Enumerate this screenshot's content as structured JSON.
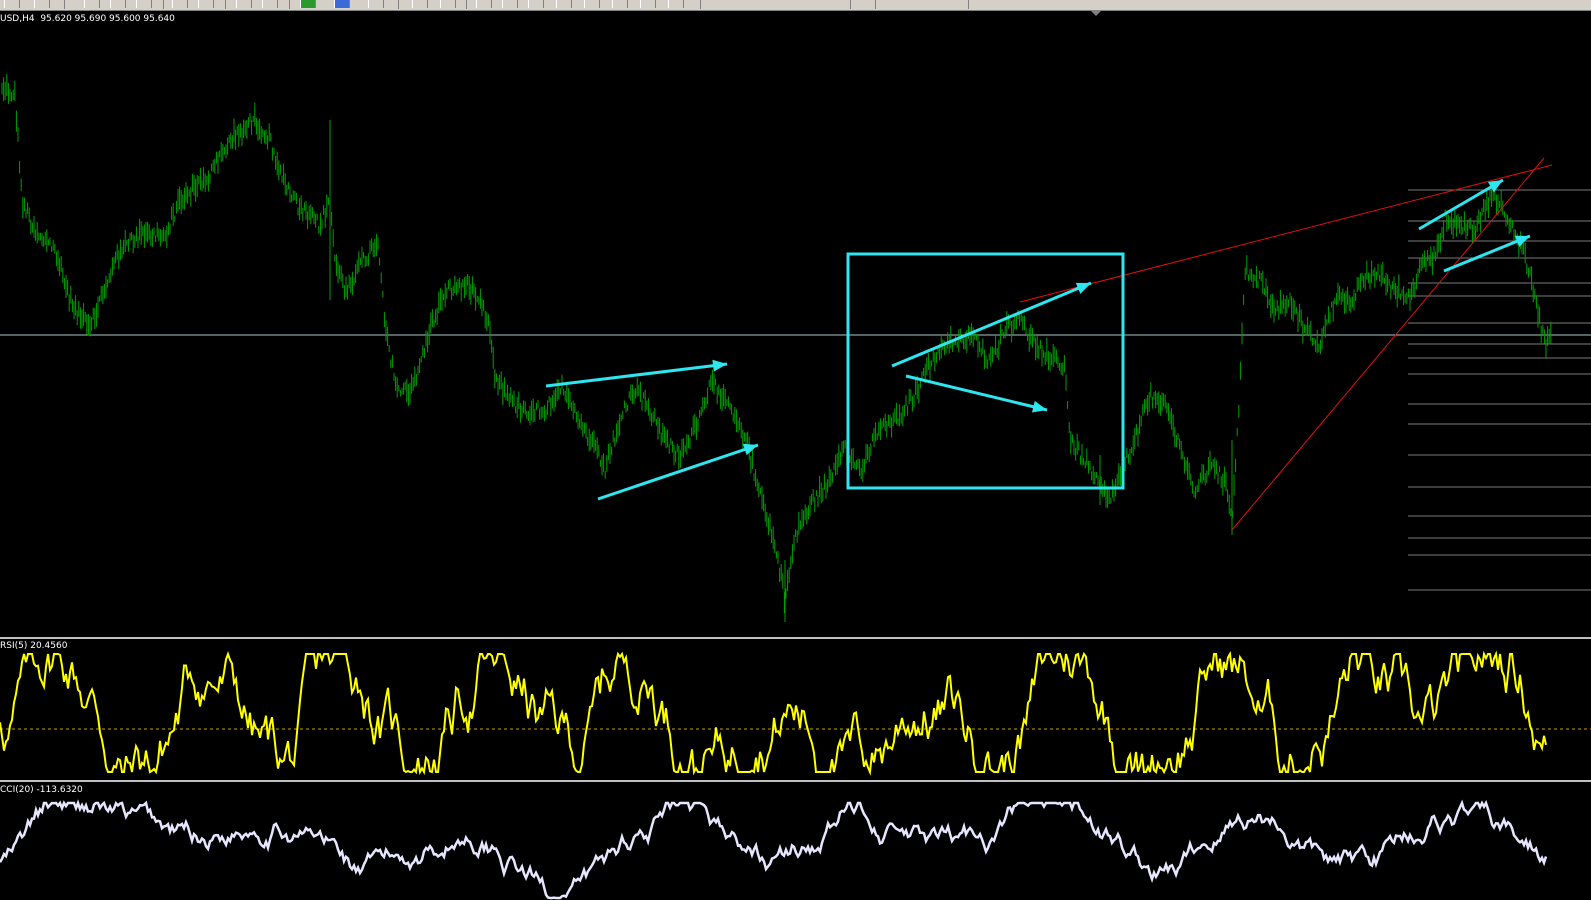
{
  "main_chart": {
    "header": "USD,H4",
    "ohlc": "95.620 95.690 95.600 95.640",
    "bar_color": "#00a000",
    "horizontal_line_color": "#a9c7c9"
  },
  "rsi_panel": {
    "label": "RSI(5) 20.4560",
    "line_color": "#ffff00",
    "level_color": "#c8a000"
  },
  "cci_panel": {
    "label": "CCI(20) -113.6320",
    "line_color": "#e6e6ff"
  },
  "annotations": {
    "arrow_color": "#2ee6f0",
    "rectangle_color": "#2ee6f0",
    "trendline_color": "#e01010"
  },
  "toolbar": {
    "icons": [
      "folder-icon",
      "save-icon",
      "zoom-in-icon",
      "zoom-out-icon",
      "tile-icon",
      "tile-icon",
      "pencil-icon",
      "pencil-icon",
      "period-icon",
      "period-icon",
      "add-indicator-icon",
      "clock-icon",
      "template-icon",
      "cursor-icon",
      "crosshair-icon",
      "line-icon",
      "line-icon",
      "fibonacci-icon",
      "shapes-icon",
      "text-icon",
      "arrow-icon"
    ]
  }
}
